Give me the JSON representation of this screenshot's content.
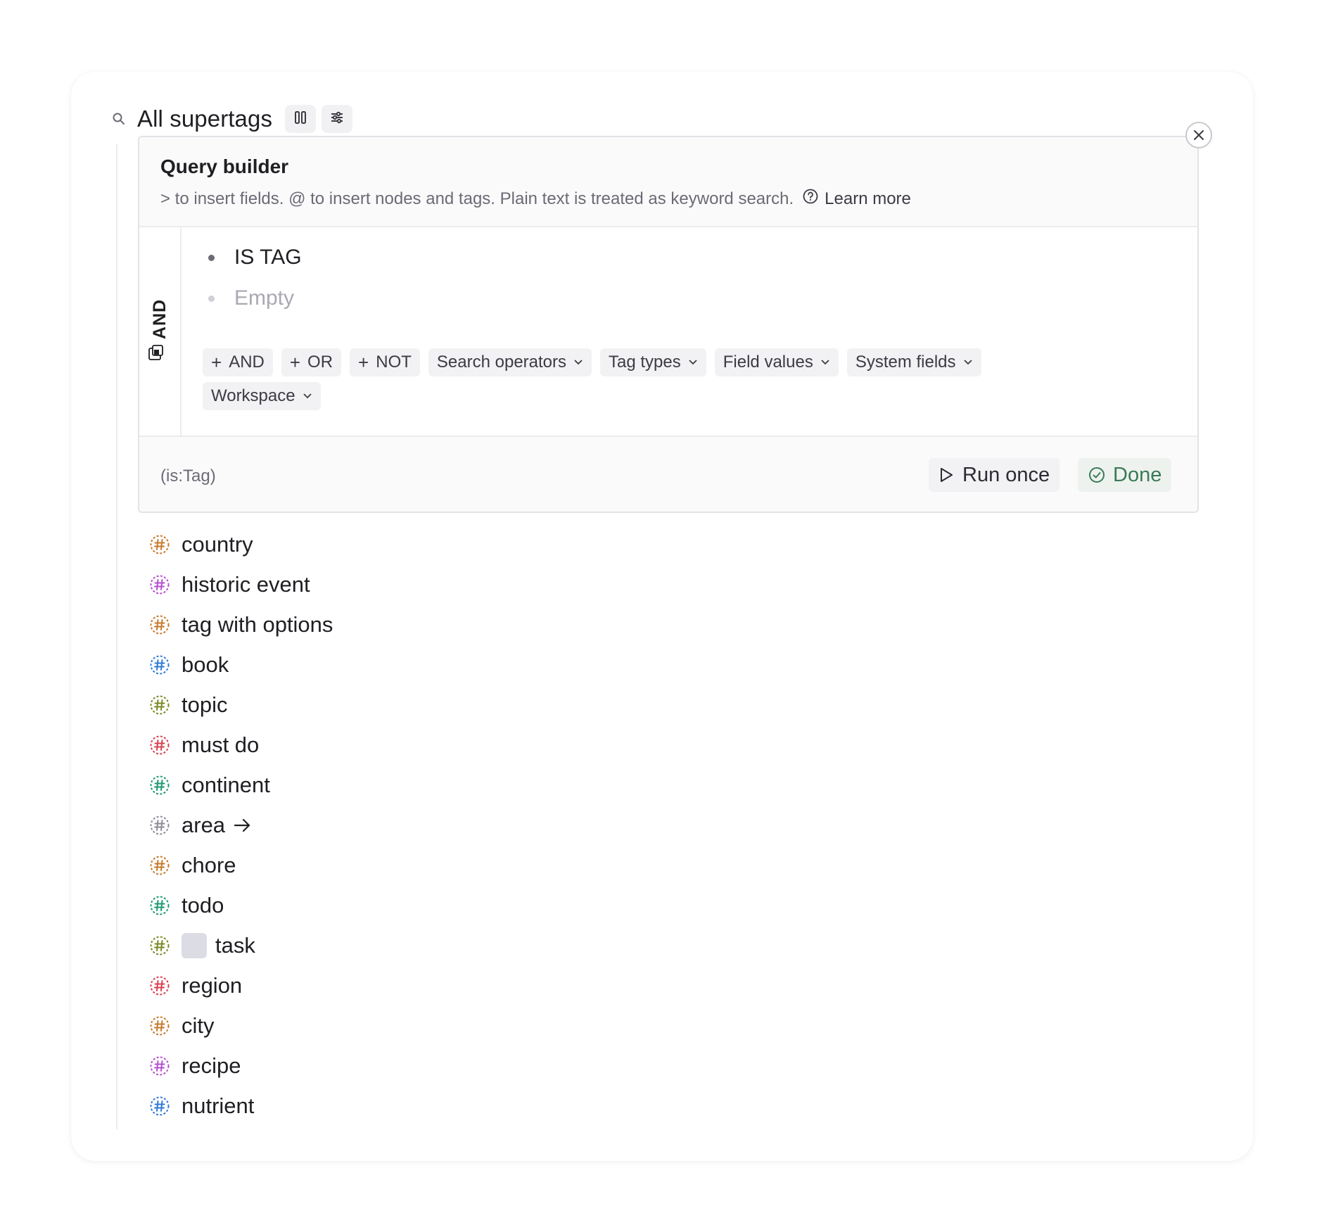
{
  "header": {
    "title": "All supertags",
    "search_icon": "search-icon",
    "columns_icon": "columns-icon",
    "filter_icon": "sliders-icon"
  },
  "query_builder": {
    "title": "Query builder",
    "hint": "> to insert fields. @ to insert nodes and tags. Plain text is treated as keyword search.",
    "learn_more": "Learn more",
    "group_operator": "AND",
    "conditions": [
      {
        "text": "IS TAG",
        "placeholder": false
      },
      {
        "text": "Empty",
        "placeholder": true
      }
    ],
    "add_buttons": [
      "AND",
      "OR",
      "NOT"
    ],
    "dropdowns": [
      "Search operators",
      "Tag types",
      "Field values",
      "System fields",
      "Workspace"
    ],
    "query_string": "(is:Tag)",
    "run_once_label": "Run once",
    "done_label": "Done"
  },
  "colors": {
    "done_green": "#3a7a55",
    "orange": "#c8792a",
    "purple": "#b54fd0",
    "blue": "#2f7ad8",
    "olive": "#7a8a22",
    "red": "#d9404f",
    "green": "#1e9a6e",
    "gray": "#8d8d97"
  },
  "tags": [
    {
      "label": "country",
      "color": "#c8792a"
    },
    {
      "label": "historic event",
      "color": "#b54fd0"
    },
    {
      "label": "tag with options",
      "color": "#c8792a"
    },
    {
      "label": "book",
      "color": "#2f7ad8"
    },
    {
      "label": "topic",
      "color": "#7a8a22"
    },
    {
      "label": "must do",
      "color": "#d9404f"
    },
    {
      "label": "continent",
      "color": "#1e9a6e"
    },
    {
      "label": "area",
      "color": "#8d8d97",
      "arrow": true
    },
    {
      "label": "chore",
      "color": "#c8792a"
    },
    {
      "label": "todo",
      "color": "#1e9a6e"
    },
    {
      "label": "task",
      "color": "#7a8a22",
      "checkbox": true
    },
    {
      "label": "region",
      "color": "#d9404f"
    },
    {
      "label": "city",
      "color": "#c8792a"
    },
    {
      "label": "recipe",
      "color": "#b54fd0"
    },
    {
      "label": "nutrient",
      "color": "#2f7ad8"
    }
  ]
}
